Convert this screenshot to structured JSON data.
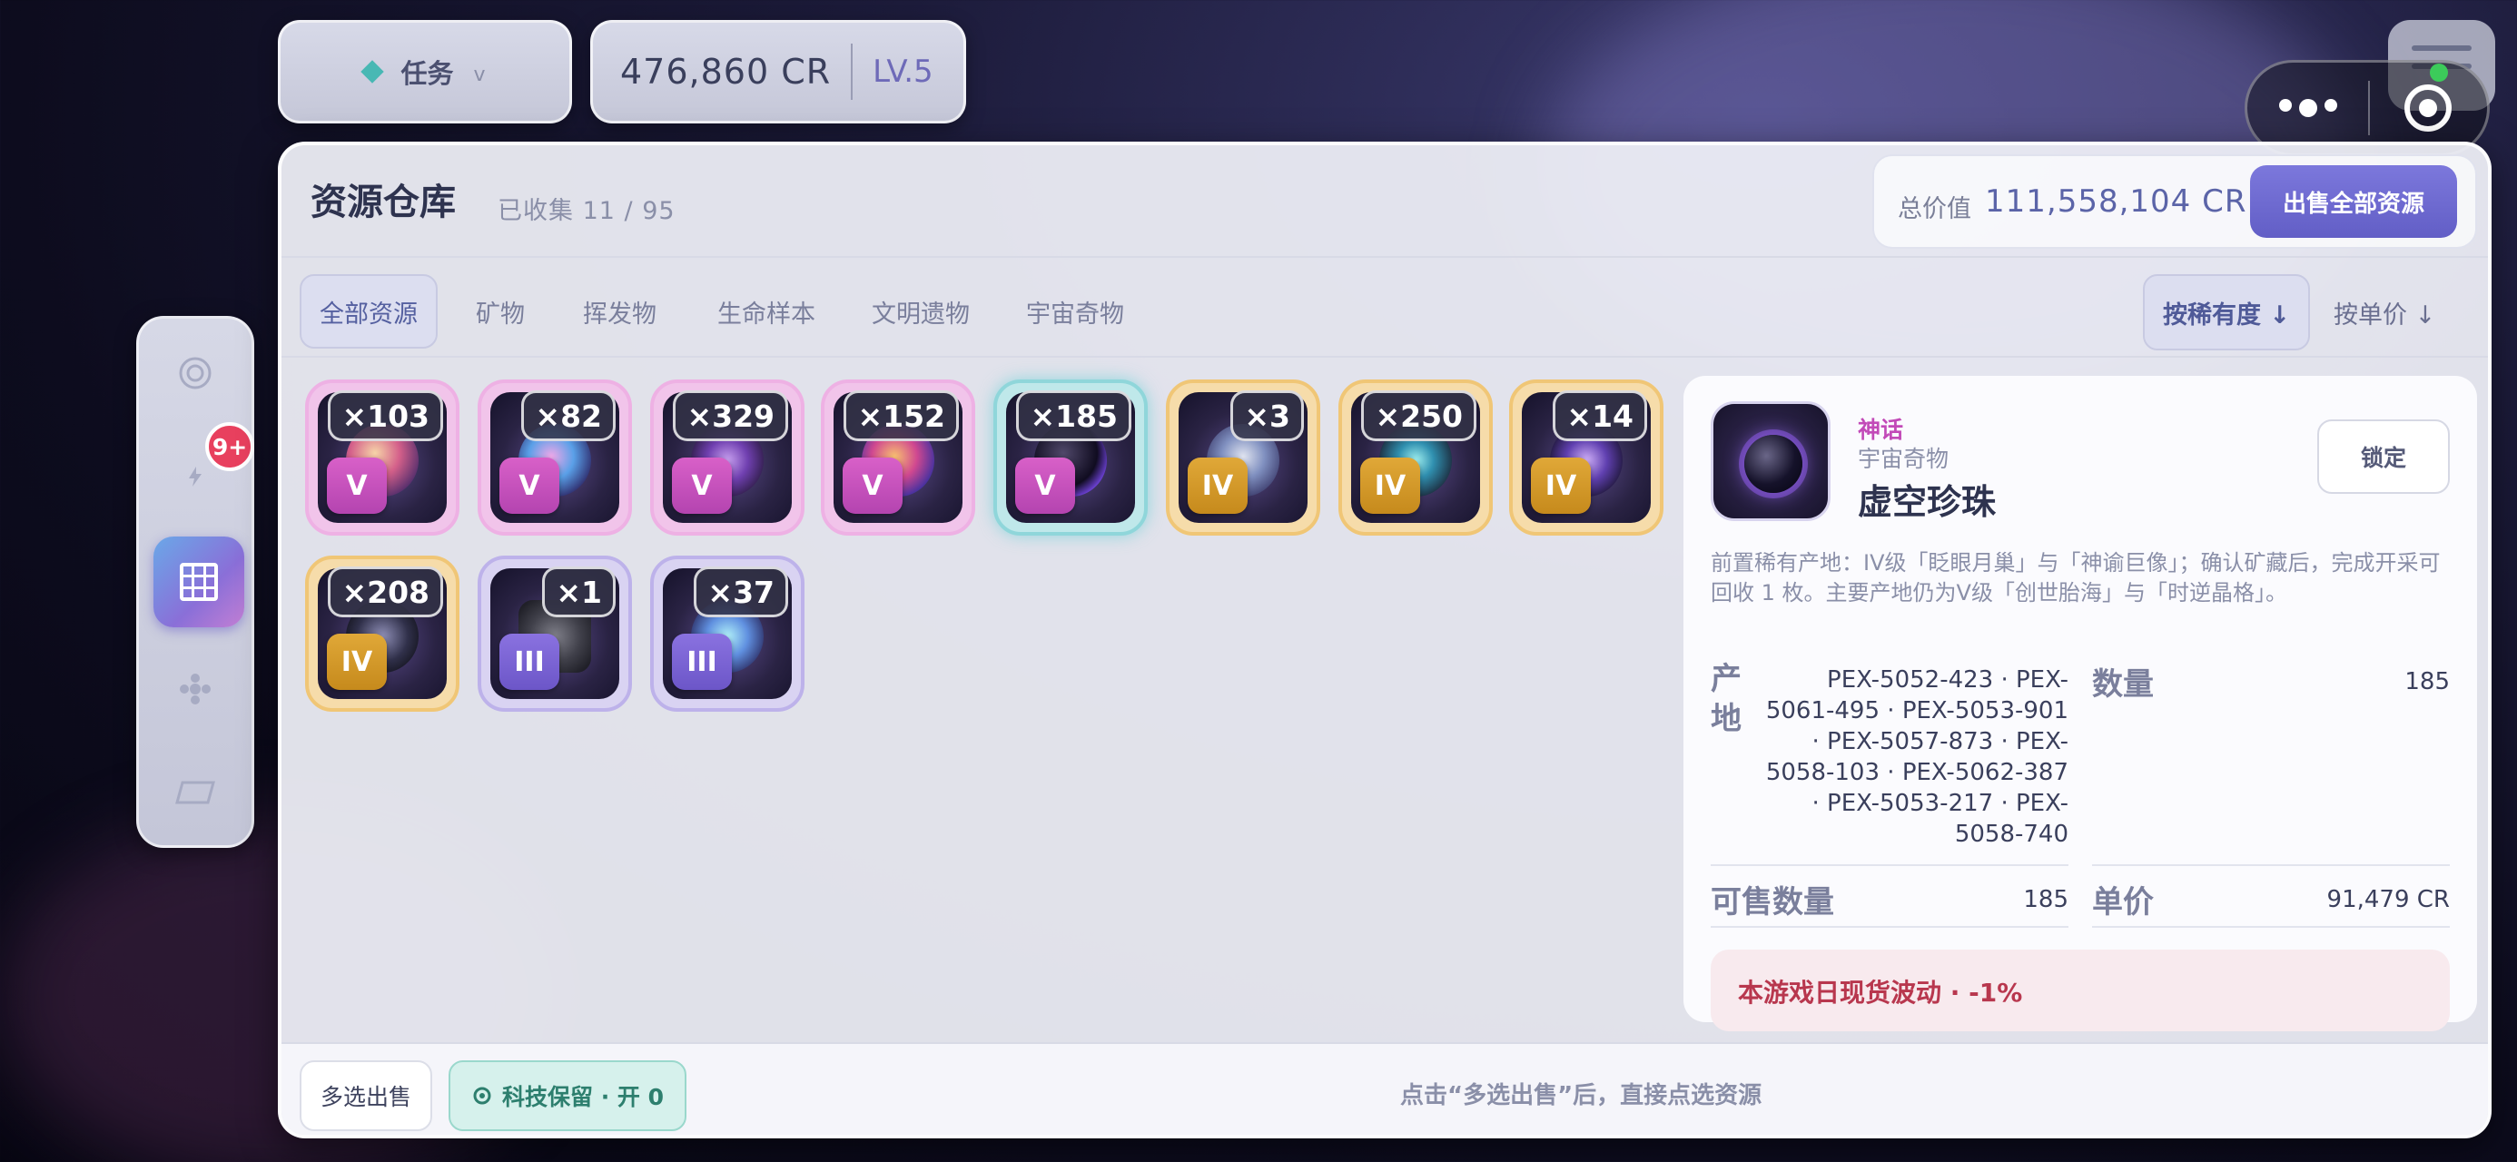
{
  "topbar": {
    "task_label": "任务",
    "task_chevron": "v",
    "credits": "476,860 CR",
    "level": "LV.5"
  },
  "nav": {
    "badge": "9+",
    "items": [
      "target-icon",
      "bolt-icon",
      "grid-icon",
      "nodes-icon",
      "card-icon"
    ]
  },
  "warehouse": {
    "title": "资源仓库",
    "collected": "已收集 11 / 95",
    "total_label": "总价值",
    "total_value": "111,558,104 CR",
    "sell_all": "出售全部资源"
  },
  "tabs": [
    "全部资源",
    "矿物",
    "挥发物",
    "生命样本",
    "文明遗物",
    "宇宙奇物"
  ],
  "sort": {
    "by_rarity": "按稀有度 ↓",
    "by_price": "按单价 ↓"
  },
  "items": [
    {
      "qty": "×103",
      "tier": "V"
    },
    {
      "qty": "×82",
      "tier": "V"
    },
    {
      "qty": "×329",
      "tier": "V"
    },
    {
      "qty": "×152",
      "tier": "V"
    },
    {
      "qty": "×185",
      "tier": "V"
    },
    {
      "qty": "×3",
      "tier": "IV"
    },
    {
      "qty": "×250",
      "tier": "IV"
    },
    {
      "qty": "×14",
      "tier": "IV"
    },
    {
      "qty": "×208",
      "tier": "IV"
    },
    {
      "qty": "×1",
      "tier": "III"
    },
    {
      "qty": "×37",
      "tier": "III"
    }
  ],
  "detail": {
    "rarity": "神话",
    "category": "宇宙奇物",
    "name": "虚空珍珠",
    "lock": "锁定",
    "description": "前置稀有产地：IV级「眨眼月巢」与「神谕巨像」；确认矿藏后，完成开采可回收 1 枚。主要产地仍为V级「创世胎海」与「时逆晶格」。",
    "origin_label": "产地",
    "origin_value": "PEX-5052-423 · PEX-5061-495 · PEX-5053-901 · PEX-5057-873 · PEX-5058-103 · PEX-5062-387 · PEX-5053-217 · PEX-5058-740",
    "qty_label": "数量",
    "qty_value": "185",
    "sellable_label": "可售数量",
    "sellable_value": "185",
    "price_label": "单价",
    "price_value": "91,479 CR",
    "fluctuation": "本游戏日现货波动 · -1%"
  },
  "footer": {
    "multi_sell": "多选出售",
    "tech_keep": "科技保留 · 开 0",
    "hint": "点击“多选出售”后，直接点选资源"
  }
}
